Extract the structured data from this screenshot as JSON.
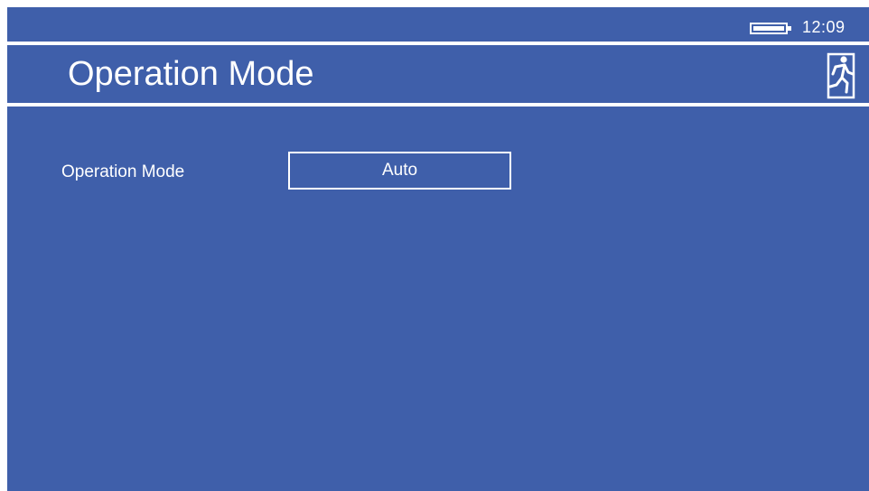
{
  "status": {
    "time": "12:09",
    "battery_icon": "battery-icon",
    "battery_level": 1.0
  },
  "header": {
    "title": "Operation Mode",
    "exit_icon": "exit-running-man-icon"
  },
  "settings": {
    "rows": [
      {
        "label": "Operation Mode",
        "value": "Auto"
      }
    ]
  },
  "colors": {
    "background": "#3f5faa",
    "foreground": "#ffffff"
  }
}
